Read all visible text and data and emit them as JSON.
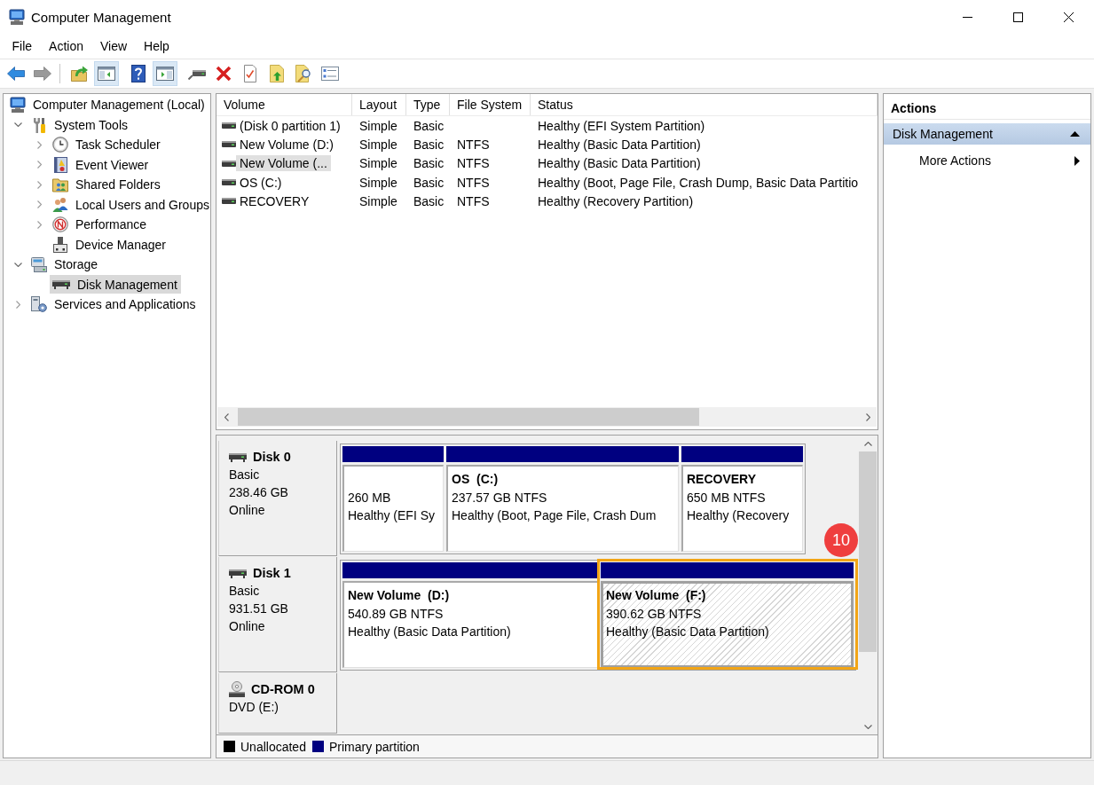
{
  "window": {
    "title": "Computer Management"
  },
  "menu": [
    "File",
    "Action",
    "View",
    "Help"
  ],
  "toolbar": {
    "groups": [
      [
        {
          "pressed": false,
          "disabled": false
        },
        {
          "pressed": false,
          "disabled": true
        }
      ],
      [
        {
          "pressed": false,
          "disabled": false
        },
        {
          "pressed": true,
          "disabled": false
        }
      ],
      [
        {
          "pressed": false,
          "disabled": false
        },
        {
          "pressed": true,
          "disabled": false
        }
      ],
      [
        {
          "pressed": false,
          "disabled": false
        },
        {
          "pressed": false,
          "disabled": false
        },
        {
          "pressed": false,
          "disabled": false
        },
        {
          "pressed": false,
          "disabled": false
        },
        {
          "pressed": false,
          "disabled": false
        },
        {
          "pressed": false,
          "disabled": false
        }
      ]
    ]
  },
  "tree": [
    {
      "label": "Computer Management (Local)",
      "selected": false,
      "children": [
        {
          "label": "System Tools",
          "expanded": true,
          "selected": false,
          "children": [
            {
              "label": "Task Scheduler",
              "expanded": false,
              "selected": false
            },
            {
              "label": "Event Viewer",
              "expanded": false,
              "selected": false
            },
            {
              "label": "Shared Folders",
              "expanded": false,
              "selected": false
            },
            {
              "label": "Local Users and Groups",
              "expanded": false,
              "selected": false
            },
            {
              "label": "Performance",
              "expanded": false,
              "selected": false
            },
            {
              "label": "Device Manager",
              "selected": false
            }
          ]
        },
        {
          "label": "Storage",
          "expanded": true,
          "selected": false,
          "children": [
            {
              "label": "Disk Management",
              "selected": true
            }
          ]
        },
        {
          "label": "Services and Applications",
          "expanded": false,
          "selected": false
        }
      ]
    }
  ],
  "volume_list": {
    "columns": [
      "Volume",
      "Layout",
      "Type",
      "File System",
      "Status"
    ],
    "rows": [
      {
        "volume": "(Disk 0 partition 1)",
        "layout": "Simple",
        "type": "Basic",
        "status": "Healthy (EFI System Partition)",
        "selected": false
      },
      {
        "volume": "New Volume (D:)",
        "layout": "Simple",
        "type": "Basic",
        "file_system": "NTFS",
        "status": "Healthy (Basic Data Partition)",
        "selected": false
      },
      {
        "volume": "New Volume (...",
        "layout": "Simple",
        "type": "Basic",
        "file_system": "NTFS",
        "status": "Healthy (Basic Data Partition)",
        "selected": true
      },
      {
        "volume": "OS (C:)",
        "layout": "Simple",
        "type": "Basic",
        "file_system": "NTFS",
        "status": "Healthy (Boot, Page File, Crash Dump, Basic Data Partitio",
        "selected": false
      },
      {
        "volume": "RECOVERY",
        "layout": "Simple",
        "type": "Basic",
        "file_system": "NTFS",
        "status": "Healthy (Recovery Partition)",
        "selected": false
      }
    ]
  },
  "disks": [
    {
      "kind": "disk",
      "name": "Disk 0",
      "details": [
        "Basic",
        "238.46 GB",
        "Online"
      ],
      "partitions": [
        {
          "size": "260 MB",
          "status": "Healthy (EFI Sy",
          "selected": false,
          "highlighted": false
        },
        {
          "title": "OS  (C:)",
          "size": "237.57 GB NTFS",
          "status": "Healthy (Boot, Page File, Crash Dum",
          "selected": false,
          "highlighted": false
        },
        {
          "title": "RECOVERY",
          "size": "650 MB NTFS",
          "status": "Healthy (Recovery",
          "selected": false,
          "highlighted": false
        }
      ]
    },
    {
      "kind": "disk",
      "name": "Disk 1",
      "details": [
        "Basic",
        "931.51 GB",
        "Online"
      ],
      "partitions": [
        {
          "title": "New Volume  (D:)",
          "size": "540.89 GB NTFS",
          "status": "Healthy (Basic Data Partition)",
          "selected": false,
          "highlighted": false
        },
        {
          "title": "New Volume  (F:)",
          "size": "390.62 GB NTFS",
          "status": "Healthy (Basic Data Partition)",
          "selected": true,
          "highlighted": true,
          "callout": "10"
        }
      ]
    },
    {
      "kind": "cdrom",
      "name": "CD-ROM 0",
      "details": [
        "DVD (E:)"
      ]
    }
  ],
  "legend": [
    {
      "label": "Unallocated",
      "color": "#000000"
    },
    {
      "label": "Primary partition",
      "color": "#000080"
    }
  ],
  "actions": {
    "title": "Actions",
    "sections": [
      {
        "label": "Disk Management",
        "expanded": true,
        "items": [
          "More Actions"
        ]
      }
    ]
  }
}
